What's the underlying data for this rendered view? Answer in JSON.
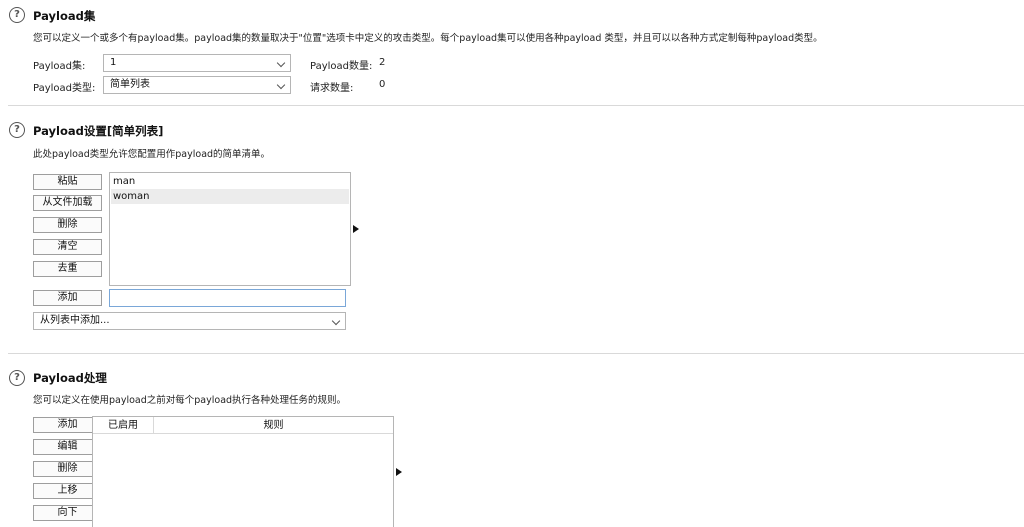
{
  "payload_sets": {
    "title": "Payload集",
    "description": "您可以定义一个或多个有payload集。payload集的数量取决于\"位置\"选项卡中定义的攻击类型。每个payload集可以使用各种payload 类型，并且可以以各种方式定制每种payload类型。",
    "set_label": "Payload集:",
    "set_value": "1",
    "type_label": "Payload类型:",
    "type_value": "简单列表",
    "count_label": "Payload数量:",
    "count_value": "2",
    "requests_label": "请求数量:",
    "requests_value": "0"
  },
  "payload_options": {
    "title": "Payload设置[简单列表]",
    "description": "此处payload类型允许您配置用作payload的简单清单。",
    "buttons": [
      "粘贴",
      "从文件加载",
      "删除",
      "清空",
      "去重"
    ],
    "items": [
      "man",
      "woman"
    ],
    "add_button": "添加",
    "add_input_value": "",
    "add_from_list": "从列表中添加..."
  },
  "payload_processing": {
    "title": "Payload处理",
    "description": "您可以定义在使用payload之前对每个payload执行各种处理任务的规则。",
    "buttons": [
      "添加",
      "编辑",
      "删除",
      "上移",
      "向下"
    ],
    "columns": [
      "已启用",
      "规则"
    ]
  },
  "help_glyph": "?"
}
